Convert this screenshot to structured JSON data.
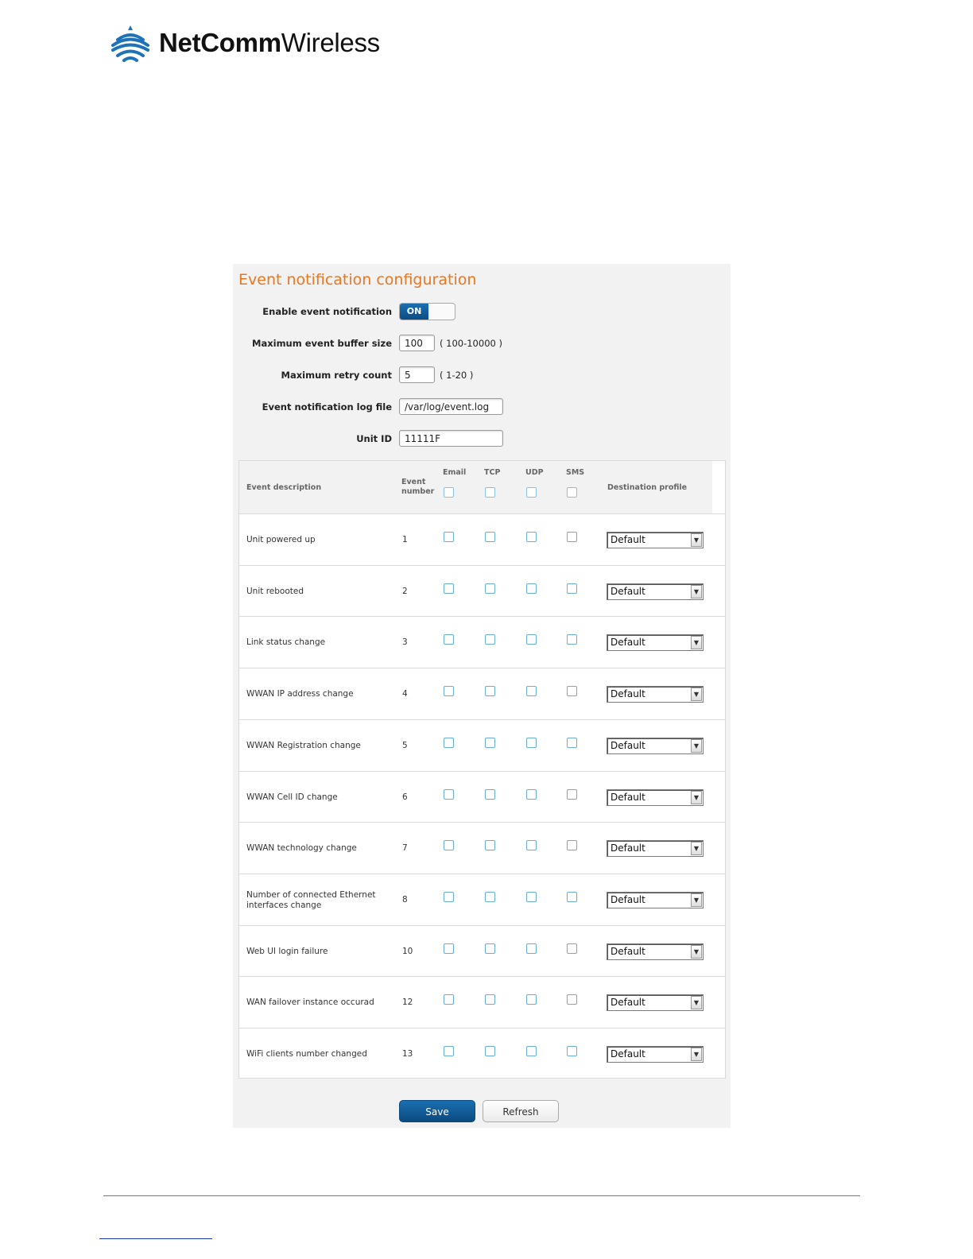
{
  "brand": {
    "logo_bold": "NetComm",
    "logo_light": "Wireless"
  },
  "panel": {
    "title": "Event notification configuration",
    "fields": {
      "enable_label": "Enable event notification",
      "enable_value": "ON",
      "buffer_label": "Maximum event buffer size",
      "buffer_value": "100",
      "buffer_hint": "( 100-10000 )",
      "retry_label": "Maximum retry count",
      "retry_value": "5",
      "retry_hint": "( 1-20 )",
      "logfile_label": "Event notification log file",
      "logfile_value": "/var/log/event.log",
      "unitid_label": "Unit ID",
      "unitid_value": "11111F"
    },
    "table": {
      "headers": {
        "description": "Event description",
        "number": "Event number",
        "email": "Email",
        "tcp": "TCP",
        "udp": "UDP",
        "sms": "SMS",
        "profile": "Destination profile"
      },
      "rows": [
        {
          "description": "Unit powered up",
          "number": "1",
          "profile": "Default"
        },
        {
          "description": "Unit rebooted",
          "number": "2",
          "profile": "Default"
        },
        {
          "description": "Link status change",
          "number": "3",
          "profile": "Default"
        },
        {
          "description": "WWAN IP address change",
          "number": "4",
          "profile": "Default"
        },
        {
          "description": "WWAN Registration change",
          "number": "5",
          "profile": "Default"
        },
        {
          "description": "WWAN Cell ID change",
          "number": "6",
          "profile": "Default"
        },
        {
          "description": "WWAN technology change",
          "number": "7",
          "profile": "Default"
        },
        {
          "description": "Number of connected Ethernet interfaces change",
          "number": "8",
          "profile": "Default"
        },
        {
          "description": "Web UI login failure",
          "number": "10",
          "profile": "Default"
        },
        {
          "description": "WAN failover instance occurad",
          "number": "12",
          "profile": "Default"
        },
        {
          "description": "WiFi clients number changed",
          "number": "13",
          "profile": "Default"
        }
      ]
    },
    "buttons": {
      "save": "Save",
      "refresh": "Refresh"
    }
  },
  "colors": {
    "title_orange": "#e87722",
    "primary_blue": "#0a4d85",
    "checkbox_border": "#6aaed6"
  }
}
